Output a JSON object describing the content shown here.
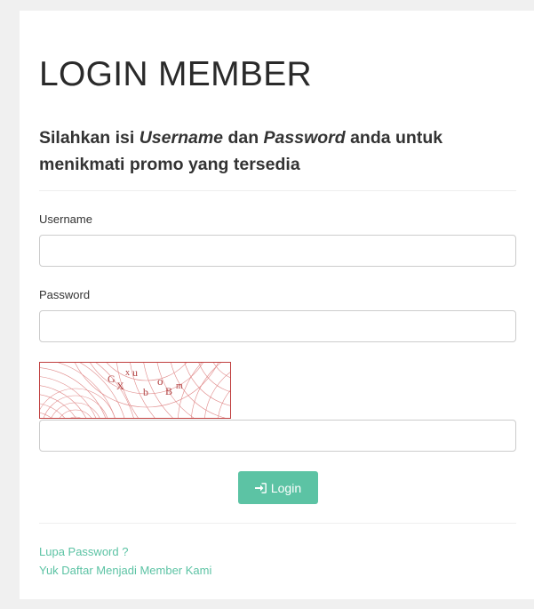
{
  "page": {
    "title": "LOGIN MEMBER",
    "subtitle_parts": [
      "Silahkan isi ",
      "Username",
      " dan ",
      "Password",
      " anda untuk menikmati promo yang tersedia"
    ]
  },
  "form": {
    "username_label": "Username",
    "username_value": "",
    "password_label": "Password",
    "password_value": "",
    "captcha_text": "GXxuboBm",
    "captcha_input_value": "",
    "login_label": "Login",
    "login_icon": "sign-in-icon"
  },
  "links": {
    "forgot_password": "Lupa Password ?",
    "register": "Yuk Daftar Menjadi Member Kami"
  },
  "colors": {
    "accent": "#5cc3a4",
    "captcha_border": "#c04040",
    "captcha_ink": "#b04040"
  }
}
